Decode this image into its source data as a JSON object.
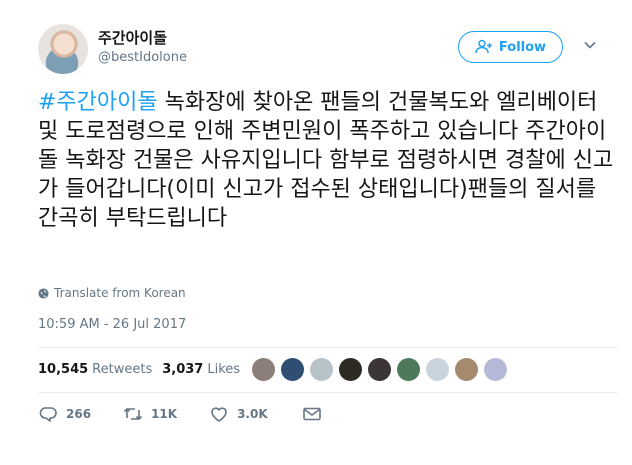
{
  "header": {
    "display_name": "주간아이돌",
    "handle": "@bestIdolone",
    "follow_label": "Follow",
    "avatar_icon": "profile-photo",
    "caret_icon": "chevron-down-icon"
  },
  "tweet": {
    "hashtag": "#주간아이돌",
    "body": " 녹화장에 찾아온 팬들의 건물복도와 엘리베이터 및 도로점령으로 인해 주변민원이 폭주하고 있습니다 주간아이돌 녹화장 건물은 사유지입니다 함부로 점령하시면 경찰에 신고가 들어갑니다(이미 신고가 접수된 상태입니다)팬들의 질서를 간곡히 부탁드립니다",
    "translate_label": "Translate from Korean",
    "timestamp": "10:59 AM - 26 Jul 2017"
  },
  "stats": {
    "retweets_count": "10,545",
    "retweets_label": "Retweets",
    "likes_count": "3,037",
    "likes_label": "Likes",
    "liker_colors": [
      "#8c7f7a",
      "#2f4e73",
      "#b7c2c9",
      "#2e2a24",
      "#3b3535",
      "#4e7a5c",
      "#c9d4dc",
      "#a58a6e",
      "#b5b8d6"
    ]
  },
  "actions": {
    "reply_count": "266",
    "retweet_count": "11K",
    "like_count": "3.0K"
  },
  "colors": {
    "accent": "#1da1f2",
    "text": "#14171a",
    "muted": "#657786",
    "divider": "#e6ecf0"
  }
}
